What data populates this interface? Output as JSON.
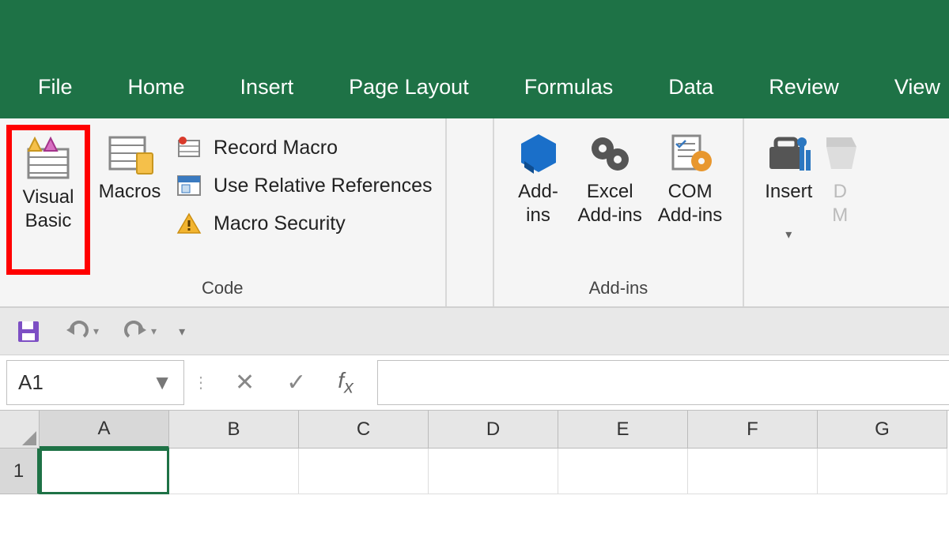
{
  "tabs": {
    "file": "File",
    "home": "Home",
    "insert": "Insert",
    "page_layout": "Page Layout",
    "formulas": "Formulas",
    "data": "Data",
    "review": "Review",
    "view": "View"
  },
  "ribbon": {
    "code": {
      "label": "Code",
      "visual_basic": "Visual\nBasic",
      "macros": "Macros",
      "record_macro": "Record Macro",
      "use_relative": "Use Relative References",
      "macro_security": "Macro Security"
    },
    "addins": {
      "label": "Add-ins",
      "addins": "Add-\nins",
      "excel_addins": "Excel\nAdd-ins",
      "com_addins": "COM\nAdd-ins"
    },
    "controls": {
      "insert": "Insert",
      "design_mode_initial": "D",
      "design_mode_rest": "M"
    }
  },
  "namebox": "A1",
  "columns": [
    "A",
    "B",
    "C",
    "D",
    "E",
    "F",
    "G"
  ],
  "rows": [
    "1"
  ],
  "active_cell": "A1"
}
